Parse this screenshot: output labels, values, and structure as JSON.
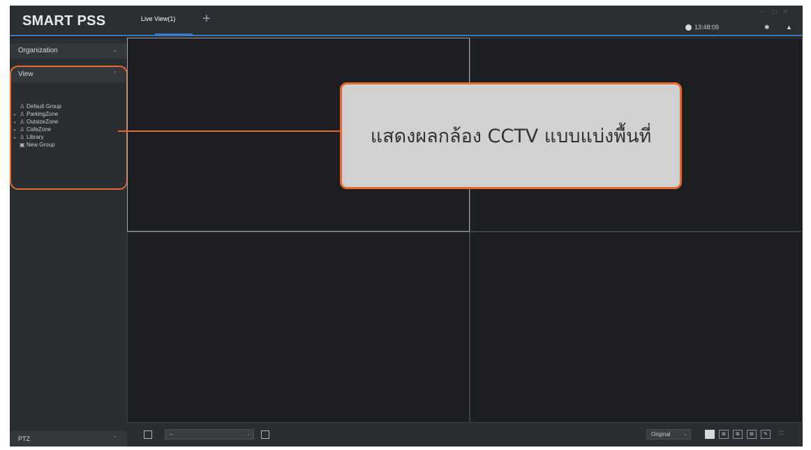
{
  "app": {
    "title": "SMART PSS",
    "tabs": [
      {
        "label": "Live View(1)"
      }
    ],
    "add_tab_label": "+",
    "time": "13:48:09"
  },
  "sidebar": {
    "organization": {
      "label": "Organization",
      "chevron": "⌄"
    },
    "view": {
      "label": "View",
      "chevron": "⌃"
    },
    "tree": [
      {
        "label": "Default Group",
        "icon": "group-icon",
        "expandable": false
      },
      {
        "label": "ParkingZone",
        "icon": "group-icon",
        "expandable": true
      },
      {
        "label": "OutsizeZone",
        "icon": "group-icon",
        "expandable": true
      },
      {
        "label": "CafeZone",
        "icon": "group-icon",
        "expandable": true
      },
      {
        "label": "Library",
        "icon": "group-icon",
        "expandable": true
      },
      {
        "label": "New Group",
        "icon": "add-group-icon",
        "expandable": false
      }
    ],
    "ptz": {
      "label": "PTZ",
      "chevron": "⌃"
    }
  },
  "bottombar": {
    "select_value": "--",
    "ratio_value": "Original"
  },
  "annotation": {
    "text": "แสดงผลกล้อง CCTV แบบแบ่งพื้นที่",
    "color": "#e46b2c"
  },
  "colors": {
    "accent": "#3a7bbf",
    "highlight": "#e46b2c",
    "background": "#1c1e22"
  }
}
